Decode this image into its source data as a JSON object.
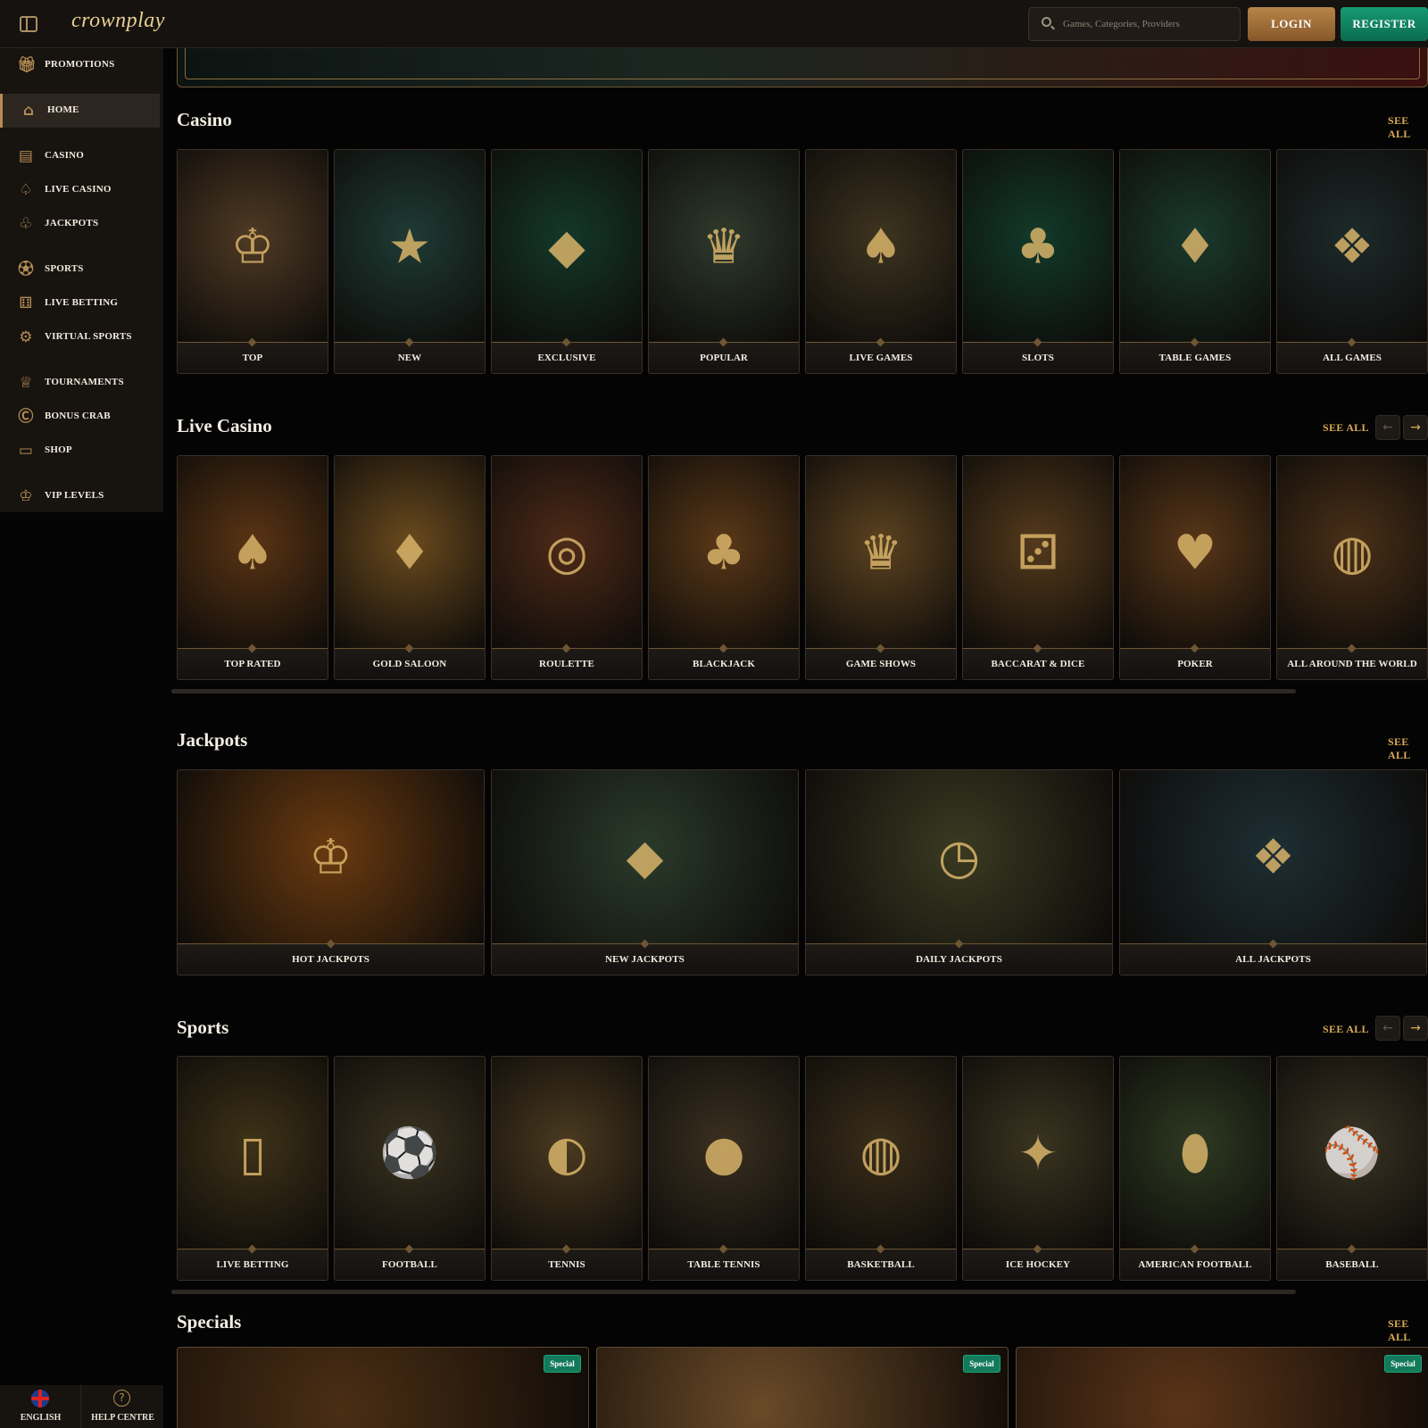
{
  "header": {
    "logo": "crownplay",
    "search_placeholder": "Games, Categories, Providers",
    "login_label": "LOGIN",
    "register_label": "REGISTER"
  },
  "sidebar": {
    "items": [
      {
        "label": "PROMOTIONS",
        "icon": "gift-icon",
        "active": false
      },
      {
        "label": "HOME",
        "icon": "home-icon",
        "active": true
      },
      {
        "label": "CASINO",
        "icon": "slot-machine-icon",
        "active": false
      },
      {
        "label": "LIVE CASINO",
        "icon": "spade-icon",
        "active": false
      },
      {
        "label": "JACKPOTS",
        "icon": "clover-icon",
        "active": false
      },
      {
        "label": "SPORTS",
        "icon": "soccer-ball-icon",
        "active": false
      },
      {
        "label": "LIVE BETTING",
        "icon": "live-betting-icon",
        "active": false
      },
      {
        "label": "VIRTUAL SPORTS",
        "icon": "gamepad-icon",
        "active": false
      },
      {
        "label": "TOURNAMENTS",
        "icon": "trophy-icon",
        "active": false
      },
      {
        "label": "BONUS CRAB",
        "icon": "bonus-crab-icon",
        "active": false
      },
      {
        "label": "SHOP",
        "icon": "shop-icon",
        "active": false
      },
      {
        "label": "VIP LEVELS",
        "icon": "crown-icon",
        "active": false
      }
    ],
    "language_label": "ENGLISH",
    "help_label": "HELP CENTRE"
  },
  "sections": {
    "casino": {
      "title": "Casino",
      "see_all": "SEE ALL",
      "cards": [
        {
          "label": "TOP",
          "bg": "#4f3a24"
        },
        {
          "label": "NEW",
          "bg": "#1f3b34"
        },
        {
          "label": "EXCLUSIVE",
          "bg": "#14382a"
        },
        {
          "label": "POPULAR",
          "bg": "#2e3a2c"
        },
        {
          "label": "LIVE GAMES",
          "bg": "#3e3420"
        },
        {
          "label": "SLOTS",
          "bg": "#123a2a"
        },
        {
          "label": "TABLE GAMES",
          "bg": "#1a3a2c"
        },
        {
          "label": "ALL GAMES",
          "bg": "#1d2a2a"
        }
      ]
    },
    "live_casino": {
      "title": "Live Casino",
      "see_all": "SEE ALL",
      "cards": [
        {
          "label": "TOP RATED",
          "bg": "#5a3414"
        },
        {
          "label": "GOLD SALOON",
          "bg": "#6a4a1e"
        },
        {
          "label": "ROULETTE",
          "bg": "#4e2a18"
        },
        {
          "label": "BLACKJACK",
          "bg": "#5a3818"
        },
        {
          "label": "GAME SHOWS",
          "bg": "#5c4220"
        },
        {
          "label": "BACCARAT & DICE",
          "bg": "#553a1c"
        },
        {
          "label": "POKER",
          "bg": "#583618"
        },
        {
          "label": "ALL AROUND THE WORLD",
          "bg": "#4a3018"
        }
      ]
    },
    "jackpots": {
      "title": "Jackpots",
      "see_all": "SEE ALL",
      "cards": [
        {
          "label": "HOT JACKPOTS",
          "bg": "#6a3a10"
        },
        {
          "label": "NEW JACKPOTS",
          "bg": "#2a3a2a"
        },
        {
          "label": "DAILY JACKPOTS",
          "bg": "#3a3a22"
        },
        {
          "label": "ALL JACKPOTS",
          "bg": "#1d2e33"
        }
      ]
    },
    "sports": {
      "title": "Sports",
      "see_all": "SEE ALL",
      "cards": [
        {
          "label": "LIVE BETTING",
          "bg": "#3e3218"
        },
        {
          "label": "FOOTBALL",
          "bg": "#3a3220"
        },
        {
          "label": "TENNIS",
          "bg": "#4a3a20"
        },
        {
          "label": "TABLE TENNIS",
          "bg": "#3a3020"
        },
        {
          "label": "BASKETBALL",
          "bg": "#3a2e1a"
        },
        {
          "label": "ICE HOCKEY",
          "bg": "#3a3420"
        },
        {
          "label": "AMERICAN FOOTBALL",
          "bg": "#2e3a22"
        },
        {
          "label": "BASEBALL",
          "bg": "#3a3424"
        }
      ]
    },
    "specials": {
      "title": "Specials",
      "see_all": "SEE ALL",
      "cards": [
        {
          "badge": "Special",
          "bg": "#4a2e14"
        },
        {
          "badge": "Special",
          "bg": "#6a4a28"
        },
        {
          "badge": "Special",
          "bg": "#5a3418"
        }
      ]
    }
  },
  "carousel": {
    "prev_icon": "←",
    "next_icon": "→"
  }
}
